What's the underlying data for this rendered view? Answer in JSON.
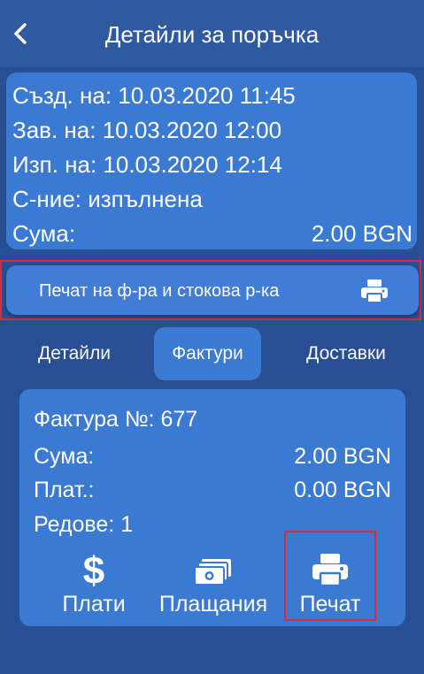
{
  "header": {
    "title": "Детайли за поръчка",
    "back_icon": "chevron-left-icon"
  },
  "order": {
    "created": "Създ. на: 10.03.2020 11:45",
    "completed": "Зав. на: 10.03.2020 12:00",
    "executed": "Изп. на: 10.03.2020 12:14",
    "status": "С-ние: изпълнена",
    "sum_label": "Сума:",
    "sum_value": "2.00 BGN"
  },
  "print_button": {
    "label": "Печат на ф-ра и стокова р-ка",
    "icon": "printer-icon"
  },
  "tabs": [
    {
      "label": "Детайли",
      "active": false
    },
    {
      "label": "Фактури",
      "active": true
    },
    {
      "label": "Доставки",
      "active": false
    }
  ],
  "invoice": {
    "number": "Фактура №: 677",
    "sum_label": "Сума:",
    "sum_value": "2.00 BGN",
    "paid_label": "Плат.:",
    "paid_value": "0.00 BGN",
    "rows": "Редове: 1"
  },
  "actions": [
    {
      "label": "Плати",
      "icon": "dollar-icon"
    },
    {
      "label": "Плащания",
      "icon": "money-bills-icon"
    },
    {
      "label": "Печат",
      "icon": "printer-icon"
    }
  ],
  "colors": {
    "background": "#284f93",
    "card": "#3b7ad3",
    "highlight": "#d92b3a"
  }
}
